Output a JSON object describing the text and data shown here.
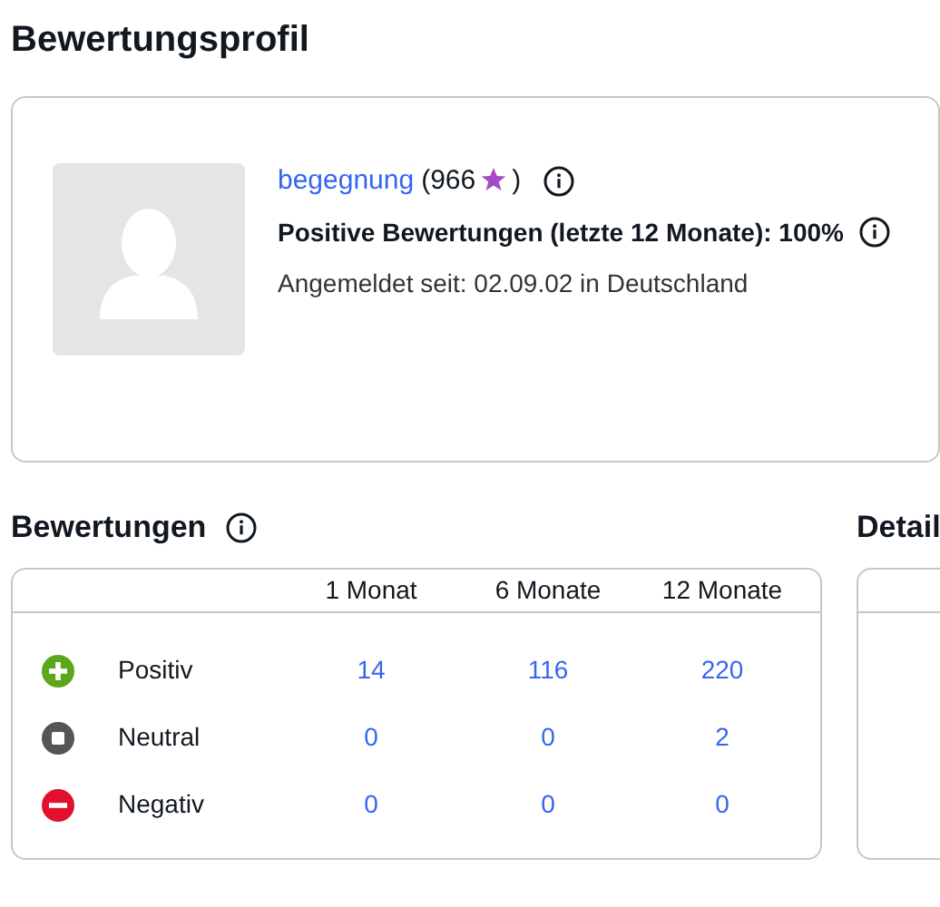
{
  "page_title": "Bewertungsprofil",
  "profile": {
    "username": "begegnung",
    "score_open": "(966",
    "score_close": ")",
    "positive_rate": "Positive Bewertungen (letzte 12 Monate): 100%",
    "member_since": "Angemeldet seit: 02.09.02 in Deutschland"
  },
  "ratings": {
    "heading": "Bewertungen",
    "columns": [
      "1 Monat",
      "6 Monate",
      "12 Monate"
    ],
    "rows": [
      {
        "kind": "positive",
        "label": "Positiv",
        "values": [
          "14",
          "116",
          "220"
        ]
      },
      {
        "kind": "neutral",
        "label": "Neutral",
        "values": [
          "0",
          "0",
          "2"
        ]
      },
      {
        "kind": "negative",
        "label": "Negativ",
        "values": [
          "0",
          "0",
          "0"
        ]
      }
    ]
  },
  "details": {
    "heading": "Detail"
  }
}
